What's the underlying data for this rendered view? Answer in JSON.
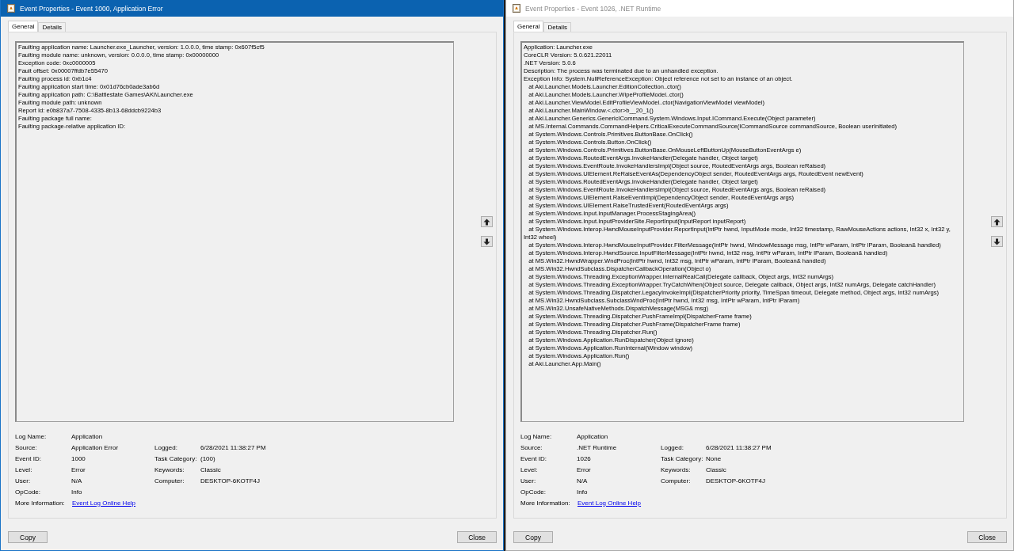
{
  "windows": [
    {
      "title": "Event Properties - Event 1000, Application Error",
      "active": true,
      "tabs": [
        {
          "label": "General",
          "selected": true
        },
        {
          "label": "Details",
          "selected": false
        }
      ],
      "description": [
        "Faulting application name: Launcher.exe_Launcher, version: 1.0.0.0, time stamp: 0x607f5cf5",
        "Faulting module name: unknown, version: 0.0.0.0, time stamp: 0x00000000",
        "Exception code: 0xc0000005",
        "Fault offset: 0x00007ffdb7e55470",
        "Faulting process id: 0xb1c4",
        "Faulting application start time: 0x01d76cb0ade3ab6d",
        "Faulting application path: C:\\Battlestate Games\\AKI\\Launcher.exe",
        "Faulting module path: unknown",
        "Report Id: e0b837a7-7508-4335-8b13-68ddcb9224b3",
        "Faulting package full name:",
        "Faulting package-relative application ID:"
      ],
      "fields_left": [
        {
          "label": "Log Name:",
          "value": "Application"
        },
        {
          "label": "Source:",
          "value": "Application Error"
        },
        {
          "label": "Event ID:",
          "value": "1000"
        },
        {
          "label": "Level:",
          "value": "Error"
        },
        {
          "label": "User:",
          "value": "N/A"
        },
        {
          "label": "OpCode:",
          "value": "Info"
        }
      ],
      "fields_right": [
        {
          "label": "Logged:",
          "value": "6/28/2021 11:38:27 PM"
        },
        {
          "label": "Task Category:",
          "value": "(100)"
        },
        {
          "label": "Keywords:",
          "value": "Classic"
        },
        {
          "label": "Computer:",
          "value": "DESKTOP-6KOTF4J"
        }
      ],
      "more_info": {
        "label": "More Information:",
        "link": "Event Log Online Help"
      },
      "buttons": [
        "Copy",
        "Close"
      ]
    },
    {
      "title": "Event Properties - Event 1026, .NET Runtime",
      "active": false,
      "tabs": [
        {
          "label": "General",
          "selected": true
        },
        {
          "label": "Details",
          "selected": false
        }
      ],
      "description": [
        "Application: Launcher.exe",
        "CoreCLR Version: 5.0.621.22011",
        ".NET Version: 5.0.6",
        "Description: The process was terminated due to an unhandled exception.",
        "Exception Info: System.NullReferenceException: Object reference not set to an instance of an object.",
        "   at Aki.Launcher.Models.Launcher.EditionCollection..ctor()",
        "   at Aki.Launcher.Models.Launcher.WipeProfileModel..ctor()",
        "   at Aki.Launcher.ViewModel.EditProfileViewModel..ctor(NavigationViewModel viewModel)",
        "   at Aki.Launcher.MainWindow.<.ctor>b__20_1()",
        "   at Aki.Launcher.Generics.GenericICommand.System.Windows.Input.ICommand.Execute(Object parameter)",
        "   at MS.Internal.Commands.CommandHelpers.CriticalExecuteCommandSource(ICommandSource commandSource, Boolean userInitiated)",
        "   at System.Windows.Controls.Primitives.ButtonBase.OnClick()",
        "   at System.Windows.Controls.Button.OnClick()",
        "   at System.Windows.Controls.Primitives.ButtonBase.OnMouseLeftButtonUp(MouseButtonEventArgs e)",
        "   at System.Windows.RoutedEventArgs.InvokeHandler(Delegate handler, Object target)",
        "   at System.Windows.EventRoute.InvokeHandlersImpl(Object source, RoutedEventArgs args, Boolean reRaised)",
        "   at System.Windows.UIElement.ReRaiseEventAs(DependencyObject sender, RoutedEventArgs args, RoutedEvent newEvent)",
        "   at System.Windows.RoutedEventArgs.InvokeHandler(Delegate handler, Object target)",
        "   at System.Windows.EventRoute.InvokeHandlersImpl(Object source, RoutedEventArgs args, Boolean reRaised)",
        "   at System.Windows.UIElement.RaiseEventImpl(DependencyObject sender, RoutedEventArgs args)",
        "   at System.Windows.UIElement.RaiseTrustedEvent(RoutedEventArgs args)",
        "   at System.Windows.Input.InputManager.ProcessStagingArea()",
        "   at System.Windows.Input.InputProviderSite.ReportInput(InputReport inputReport)",
        "   at System.Windows.Interop.HwndMouseInputProvider.ReportInput(IntPtr hwnd, InputMode mode, Int32 timestamp, RawMouseActions actions, Int32 x, Int32 y, Int32 wheel)",
        "   at System.Windows.Interop.HwndMouseInputProvider.FilterMessage(IntPtr hwnd, WindowMessage msg, IntPtr wParam, IntPtr lParam, Boolean& handled)",
        "   at System.Windows.Interop.HwndSource.InputFilterMessage(IntPtr hwnd, Int32 msg, IntPtr wParam, IntPtr lParam, Boolean& handled)",
        "   at MS.Win32.HwndWrapper.WndProc(IntPtr hwnd, Int32 msg, IntPtr wParam, IntPtr lParam, Boolean& handled)",
        "   at MS.Win32.HwndSubclass.DispatcherCallbackOperation(Object o)",
        "   at System.Windows.Threading.ExceptionWrapper.InternalRealCall(Delegate callback, Object args, Int32 numArgs)",
        "   at System.Windows.Threading.ExceptionWrapper.TryCatchWhen(Object source, Delegate callback, Object args, Int32 numArgs, Delegate catchHandler)",
        "   at System.Windows.Threading.Dispatcher.LegacyInvokeImpl(DispatcherPriority priority, TimeSpan timeout, Delegate method, Object args, Int32 numArgs)",
        "   at MS.Win32.HwndSubclass.SubclassWndProc(IntPtr hwnd, Int32 msg, IntPtr wParam, IntPtr lParam)",
        "   at MS.Win32.UnsafeNativeMethods.DispatchMessage(MSG& msg)",
        "   at System.Windows.Threading.Dispatcher.PushFrameImpl(DispatcherFrame frame)",
        "   at System.Windows.Threading.Dispatcher.PushFrame(DispatcherFrame frame)",
        "   at System.Windows.Threading.Dispatcher.Run()",
        "   at System.Windows.Application.RunDispatcher(Object ignore)",
        "   at System.Windows.Application.RunInternal(Window window)",
        "   at System.Windows.Application.Run()",
        "   at Aki.Launcher.App.Main()"
      ],
      "fields_left": [
        {
          "label": "Log Name:",
          "value": "Application"
        },
        {
          "label": "Source:",
          "value": ".NET Runtime"
        },
        {
          "label": "Event ID:",
          "value": "1026"
        },
        {
          "label": "Level:",
          "value": "Error"
        },
        {
          "label": "User:",
          "value": "N/A"
        },
        {
          "label": "OpCode:",
          "value": "Info"
        }
      ],
      "fields_right": [
        {
          "label": "Logged:",
          "value": "6/28/2021 11:38:27 PM"
        },
        {
          "label": "Task Category:",
          "value": "None"
        },
        {
          "label": "Keywords:",
          "value": "Classic"
        },
        {
          "label": "Computer:",
          "value": "DESKTOP-6KOTF4J"
        }
      ],
      "more_info": {
        "label": "More Information:",
        "link": "Event Log Online Help"
      },
      "buttons": [
        "Copy",
        "Close"
      ]
    }
  ]
}
